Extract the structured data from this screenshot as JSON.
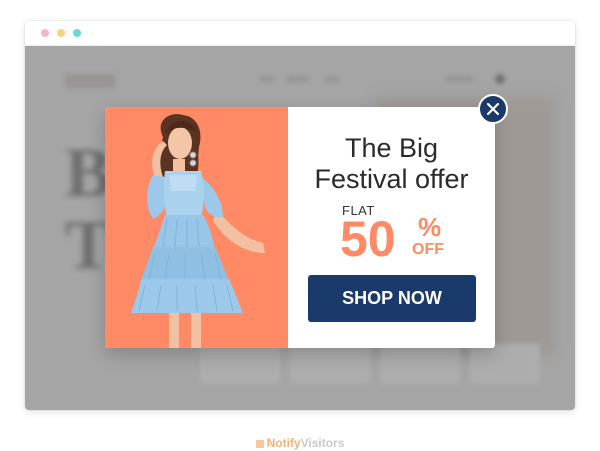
{
  "window": {
    "controls": [
      "close",
      "minimize",
      "maximize"
    ]
  },
  "background_page": {
    "hero_letters": [
      "B",
      "T"
    ]
  },
  "popup": {
    "headline_line1": "The Big",
    "headline_line2": "Festival offer",
    "flat_label": "FLAT",
    "discount_value": "50",
    "percent_sign": "%",
    "off_label": "OFF",
    "shop_button_label": "SHOP NOW",
    "close_icon": "close-icon",
    "image_subject": "model-in-light-blue-dress"
  },
  "colors": {
    "accent": "#ff8a65",
    "primary": "#1a3a6c",
    "dress": "#9cc9ea"
  },
  "branding": {
    "part1": "Notify",
    "part2": "Visitors"
  }
}
